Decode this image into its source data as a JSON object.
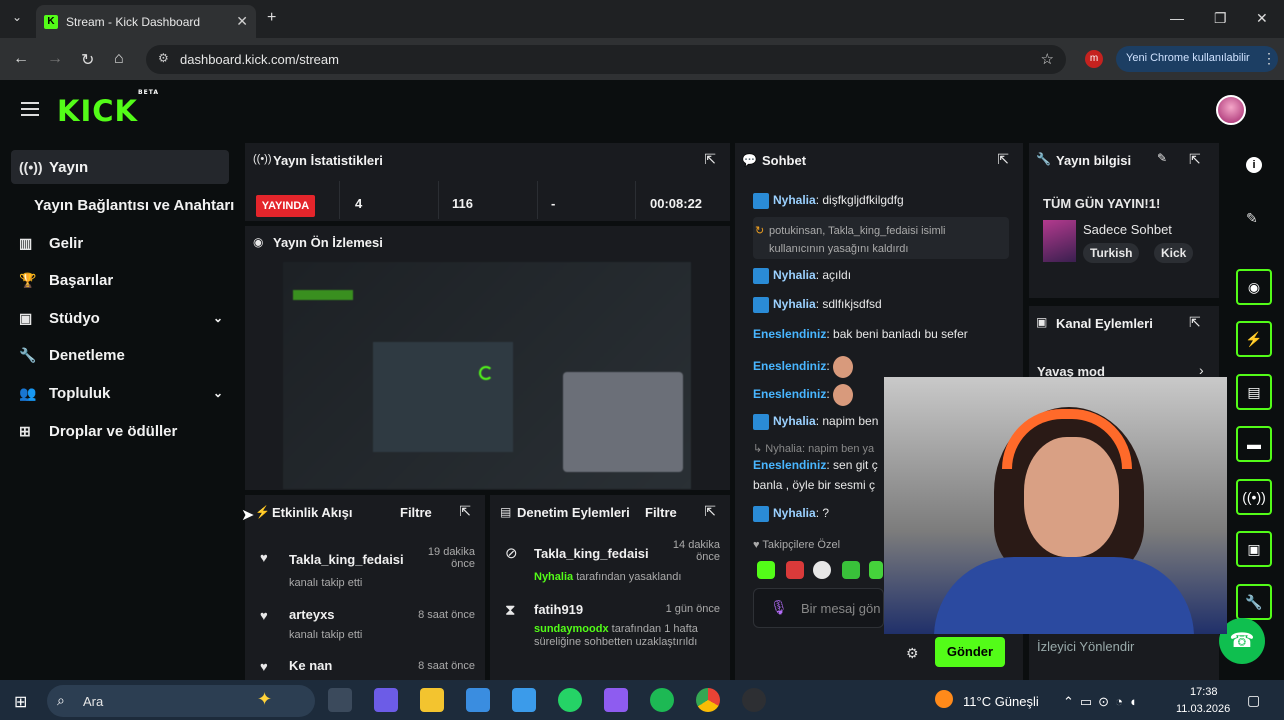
{
  "browser": {
    "tab_title": "Stream - Kick Dashboard",
    "url": "dashboard.kick.com/stream",
    "new_chrome": "Yeni Chrome kullanılabilir",
    "ext_letter": "m"
  },
  "app": {
    "logo": "KICK",
    "logo_sup": "BETA"
  },
  "sidebar": {
    "items": [
      {
        "label": "Yayın",
        "icon": "broadcast-icon"
      },
      {
        "label": "Yayın Bağlantısı ve Anahtarı",
        "icon": ""
      },
      {
        "label": "Gelir",
        "icon": "chart-icon"
      },
      {
        "label": "Başarılar",
        "icon": "trophy-icon"
      },
      {
        "label": "Stüdyo",
        "icon": "studio-icon"
      },
      {
        "label": "Denetleme",
        "icon": "wrench-icon"
      },
      {
        "label": "Topluluk",
        "icon": "people-icon"
      },
      {
        "label": "Droplar ve ödüller",
        "icon": "gift-icon"
      }
    ]
  },
  "stats": {
    "title": "Yayın İstatistikleri",
    "live": "YAYINDA",
    "values": [
      "4",
      "116",
      "-",
      "00:08:22"
    ]
  },
  "preview": {
    "title": "Yayın Ön İzlemesi"
  },
  "events": {
    "title": "Etkinlik Akışı",
    "filter": "Filtre",
    "items": [
      {
        "name": "Takla_king_fedaisi",
        "sub": "kanalı takip etti",
        "time": "19 dakika önce"
      },
      {
        "name": "arteyxs",
        "sub": "kanalı takip etti",
        "time": "8 saat önce"
      },
      {
        "name": "Ke nan",
        "sub": "",
        "time": "8 saat önce"
      }
    ]
  },
  "mod": {
    "title": "Denetim Eylemleri",
    "filter": "Filtre",
    "items": [
      {
        "name": "Takla_king_fedaisi",
        "time": "14 dakika önce",
        "actor": "Nyhalia",
        "text": "tarafından yasaklandı"
      },
      {
        "name": "fatih919",
        "time": "1 gün önce",
        "actor": "sundaymoodx",
        "text": "tarafından 1 hafta süreliğine sohbetten uzaklaştırıldı"
      }
    ]
  },
  "chat": {
    "title": "Sohbet",
    "messages": [
      {
        "user": "Nyhalia",
        "text": "dişfkgljdfkilgdfg"
      },
      {
        "user": "",
        "text": "potukinsan, Takla_king_fedaisi isimli kullanıcının yasağını kaldırdı"
      },
      {
        "user": "Nyhalia",
        "text": "açıldı"
      },
      {
        "user": "Nyhalia",
        "text": "sdlfıkjsdfsd"
      },
      {
        "user": "Eneslendiniz",
        "text": "bak beni banladı bu sefer"
      },
      {
        "user": "Eneslendiniz",
        "text": ""
      },
      {
        "user": "Eneslendiniz",
        "text": ""
      },
      {
        "user": "Nyhalia",
        "text": "napim ben"
      },
      {
        "user": "",
        "text": "Nyhalia: napim ben ya"
      },
      {
        "user": "Eneslendiniz",
        "text": "sen git ç"
      },
      {
        "user": "",
        "text": "banla , öyle bir sesmi ç"
      },
      {
        "user": "Nyhalia",
        "text": "?"
      }
    ],
    "followers_only": "Takipçilere Özel",
    "placeholder": "Bir mesaj gön",
    "send": "Gönder"
  },
  "info": {
    "title": "Yayın bilgisi",
    "stream_title": "TÜM GÜN YAYIN!1!",
    "category": "Sadece Sohbet",
    "tags": [
      "Turkish",
      "Kick"
    ]
  },
  "channel_actions": {
    "title": "Kanal Eylemleri",
    "slow_mode": "Yavaş mod",
    "viewer_redirect": "İzleyici Yönlendir"
  },
  "taskbar": {
    "search": "Ara",
    "weather": "11°C  Güneşli",
    "time": "17:38",
    "date": "11.03.2026"
  }
}
